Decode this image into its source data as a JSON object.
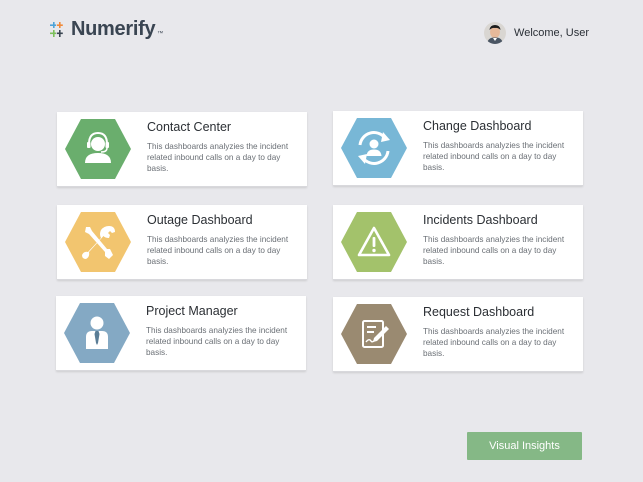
{
  "app": {
    "name": "Numerify",
    "trademark": "™",
    "welcome_text": "Welcome, User"
  },
  "cards": [
    {
      "title": "Contact Center",
      "description": "This dashboards analyzies the incident related inbound calls on a day to day basis.",
      "icon": "headset-agent-icon",
      "color": "#6aae6d"
    },
    {
      "title": "Change Dashboard",
      "description": "This dashboards analyzies the incident related inbound calls on a day to day basis.",
      "icon": "user-refresh-icon",
      "color": "#78b7d6"
    },
    {
      "title": "Outage Dashboard",
      "description": "This dashboards analyzies the incident related inbound calls on a day to day basis.",
      "icon": "wrench-screwdriver-icon",
      "color": "#f2c56f"
    },
    {
      "title": "Incidents Dashboard",
      "description": "This dashboards analyzies the incident related inbound calls on a day to day basis.",
      "icon": "warning-icon",
      "color": "#a3c26b"
    },
    {
      "title": "Project Manager",
      "description": "This dashboards analyzies the incident related inbound calls on a day to day basis.",
      "icon": "businessman-icon",
      "color": "#84a9c4"
    },
    {
      "title": "Request Dashboard",
      "description": "This dashboards analyzies the incident related inbound calls on a day to day basis.",
      "icon": "request-form-icon",
      "color": "#9a8a71"
    }
  ],
  "cta": {
    "label": "Visual Insights",
    "color": "#85b886"
  }
}
